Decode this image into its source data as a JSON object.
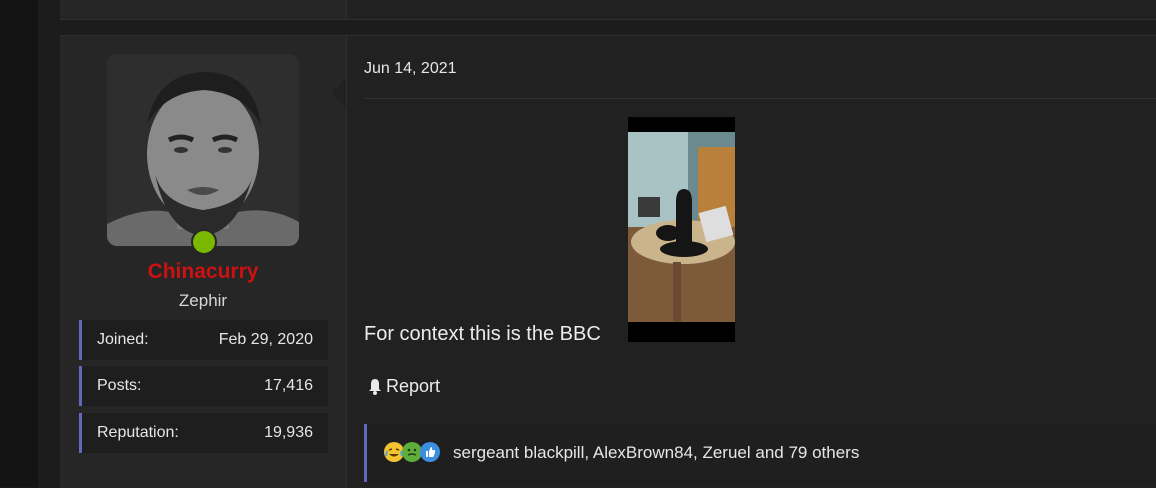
{
  "post": {
    "username": "Chinacurry",
    "user_title": "Zephir",
    "online": true,
    "stats": [
      {
        "label": "Joined:",
        "value": "Feb 29, 2020"
      },
      {
        "label": "Posts:",
        "value": "17,416"
      },
      {
        "label": "Reputation:",
        "value": "19,936"
      }
    ],
    "date": "Jun 14, 2021",
    "body_text": "For context this is the BBC",
    "report_label": "Report",
    "reactions": {
      "icons": [
        "laughing-crying-icon",
        "sick-face-icon",
        "thumbs-up-icon"
      ],
      "text": "sergeant blackpill, AlexBrown84, Zeruel and 79 others"
    }
  },
  "colors": {
    "username": "#cc1111",
    "accent_bar": "#5d6abf",
    "online": "#7ab800"
  }
}
